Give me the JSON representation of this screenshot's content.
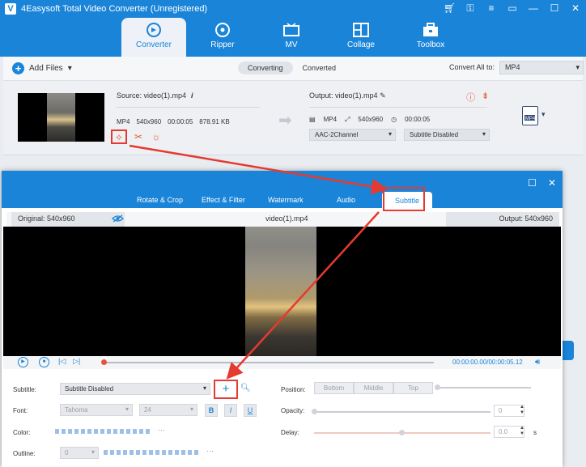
{
  "app": {
    "title": "4Easysoft Total Video Converter (Unregistered)",
    "logo": "V"
  },
  "nav": [
    {
      "label": "Converter",
      "icon": "converter-icon",
      "active": true
    },
    {
      "label": "Ripper",
      "icon": "ripper-icon"
    },
    {
      "label": "MV",
      "icon": "mv-icon"
    },
    {
      "label": "Collage",
      "icon": "collage-icon"
    },
    {
      "label": "Toolbox",
      "icon": "toolbox-icon"
    }
  ],
  "toolbar": {
    "add_files": "Add Files",
    "converting": "Converting",
    "converted": "Converted",
    "convert_all_label": "Convert All to:",
    "convert_all_value": "MP4"
  },
  "file": {
    "source": "Source: video(1).mp4",
    "format": "MP4",
    "resolution": "540x960",
    "duration": "00:00:05",
    "size": "878.91 KB",
    "output": "Output: video(1).mp4",
    "out_format": "MP4",
    "out_resolution": "540x960",
    "out_duration": "00:00:05",
    "audio": "AAC-2Channel",
    "subtitle": "Subtitle Disabled",
    "badge": "MP4"
  },
  "dialog": {
    "tabs": [
      "Rotate & Crop",
      "Effect & Filter",
      "Watermark",
      "Audio",
      "Subtitle"
    ],
    "active_tab": "Subtitle",
    "original": "Original: 540x960",
    "output": "Output: 540x960",
    "filename": "video(1).mp4",
    "time": "00:00:00.00/00:00:05.12",
    "progress": 0,
    "labels": {
      "subtitle": "Subtitle:",
      "font": "Font:",
      "color": "Color:",
      "outline": "Outline:",
      "position": "Position:",
      "opacity": "Opacity:",
      "delay": "Delay:"
    },
    "subtitle_value": "Subtitle Disabled",
    "font_value": "Tahoma",
    "font_size": "24",
    "style_buttons": [
      "B",
      "I",
      "U"
    ],
    "outline_value": "0",
    "positions": [
      "Bottom",
      "Middle",
      "Top"
    ],
    "opacity_value": "0",
    "delay_value": "0.0",
    "delay_unit": "s"
  },
  "colors": {
    "brand": "#1a84d8",
    "highlight": "#e53a30",
    "accent": "#e55a36"
  }
}
